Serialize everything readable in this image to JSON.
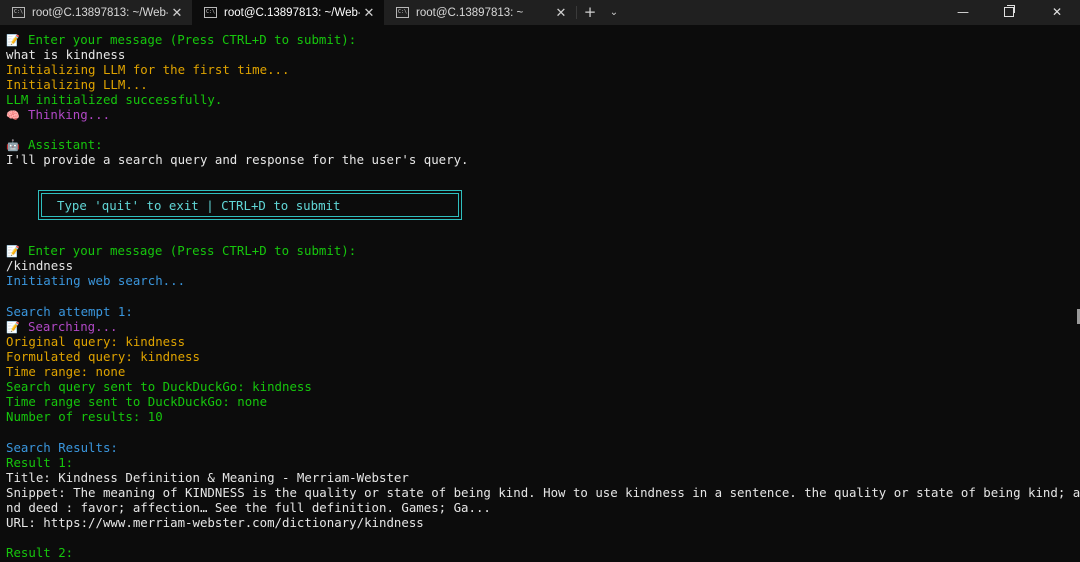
{
  "tabs": [
    {
      "label": "root@C.13897813: ~/Web-LLM",
      "active": false
    },
    {
      "label": "root@C.13897813: ~/Web-LLM",
      "active": true
    },
    {
      "label": "root@C.13897813: ~",
      "active": false
    }
  ],
  "tab_close_glyph": "✕",
  "new_tab_glyph": "+",
  "dropdown_glyph": "⌄",
  "window_controls": {
    "minimize": "—",
    "close": "✕"
  },
  "colors": {
    "background": "#0c0c0c",
    "tabbar": "#202020",
    "white": "#e6e6e6",
    "green": "#16c60c",
    "yellow": "#dfa300",
    "purple": "#b148c6",
    "blue": "#3a96dd",
    "cyan": "#61d6d6"
  },
  "terminal": {
    "prompt1": "Enter your message (Press CTRL+D to submit):",
    "input1": "what is kindness",
    "init_first": "Initializing LLM for the first time...",
    "init": "Initializing LLM...",
    "init_ok": "LLM initialized successfully.",
    "thinking": "Thinking...",
    "assistant": "Assistant:",
    "assistant_reply": "I'll provide a search query and response for the user's query.",
    "box_text": "Type 'quit' to exit | CTRL+D to submit",
    "prompt2": "Enter your message (Press CTRL+D to submit):",
    "input2": "/kindness",
    "init_search": "Initiating web search...",
    "attempt": "Search attempt 1:",
    "searching": "Searching...",
    "original_query": "Original query: kindness",
    "formulated_query": "Formulated query: kindness",
    "time_range": "Time range: none",
    "query_sent": "Search query sent to DuckDuckGo: kindness",
    "time_sent": "Time range sent to DuckDuckGo: none",
    "num_results": "Number of results: 10",
    "results_header": "Search Results:",
    "result1_label": "Result 1:",
    "result1_title": "Title: Kindness Definition & Meaning - Merriam-Webster",
    "result1_snippet_1": "Snippet: The meaning of KINDNESS is the quality or state of being kind. How to use kindness in a sentence. the quality or state of being kind; a ki",
    "result1_snippet_2": "nd deed : favor; affection… See the full definition. Games; Ga...",
    "result1_url": "URL: https://www.merriam-webster.com/dictionary/kindness",
    "result2_label": "Result 2:"
  },
  "icons": {
    "memo": "memo-icon",
    "brain": "brain-icon",
    "robot": "robot-icon",
    "terminal": "terminal-icon"
  }
}
